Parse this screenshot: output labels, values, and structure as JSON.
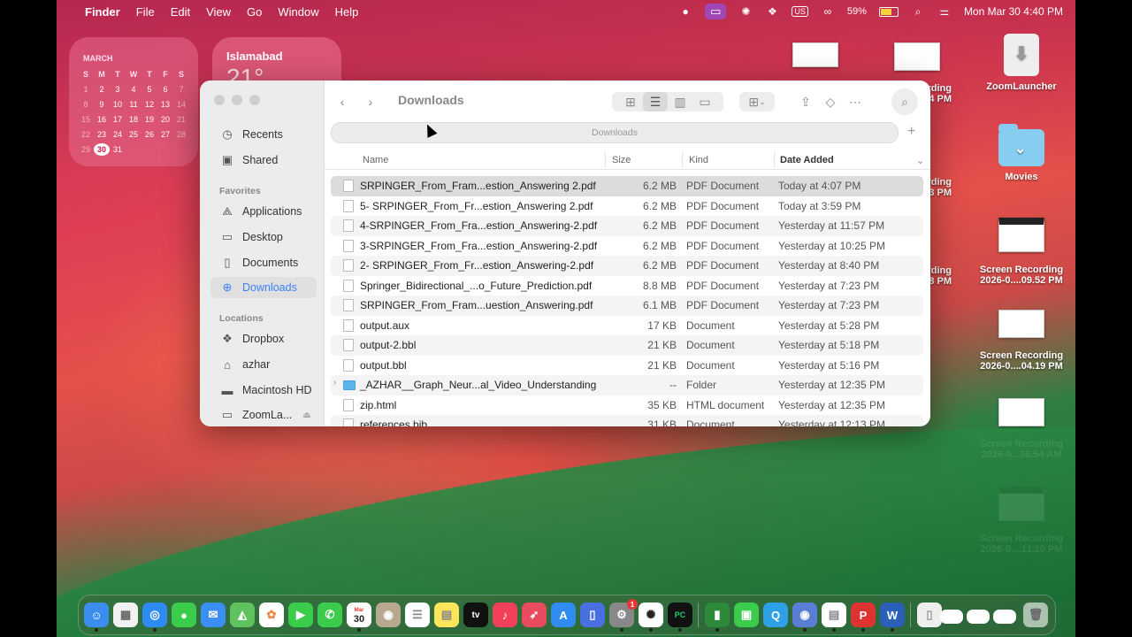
{
  "menubar": {
    "app_name": "Finder",
    "menus": [
      "File",
      "Edit",
      "View",
      "Go",
      "Window",
      "Help"
    ],
    "input_source": "US",
    "battery": "59%",
    "battery_level": 0.59,
    "datetime": "Mon Mar 30  4:40 PM"
  },
  "calendar_widget": {
    "month": "MARCH",
    "weekdays": [
      "S",
      "M",
      "T",
      "W",
      "T",
      "F",
      "S"
    ],
    "days": [
      "1",
      "2",
      "3",
      "4",
      "5",
      "6",
      "7",
      "8",
      "9",
      "10",
      "11",
      "12",
      "13",
      "14",
      "15",
      "16",
      "17",
      "18",
      "19",
      "20",
      "21",
      "22",
      "23",
      "24",
      "25",
      "26",
      "27",
      "28",
      "29",
      "30",
      "31"
    ],
    "today": "30"
  },
  "weather_widget": {
    "city": "Islamabad",
    "temp": "21°"
  },
  "desktop": {
    "items": [
      {
        "label": "ZoomLauncher"
      },
      {
        "label": "Movies"
      },
      {
        "label": "Screen Recording 2026-0....09.52 PM"
      },
      {
        "label": "Screen Recording 2026-0....04.19 PM"
      },
      {
        "label": "Screen Recording 2026-0...36.54 AM"
      },
      {
        "label": "Screen Recording 2026-0....11.10 PM"
      }
    ],
    "partial_labels": [
      "cording",
      "3.54 PM",
      "ecording",
      "4.33 PM",
      "cording",
      "3.48 PM"
    ]
  },
  "finder": {
    "title": "Downloads",
    "path_bar": "Downloads",
    "sidebar": {
      "top_items": [
        {
          "label": "Recents"
        },
        {
          "label": "Shared"
        }
      ],
      "favorites_header": "Favorites",
      "favorites": [
        {
          "label": "Applications"
        },
        {
          "label": "Desktop"
        },
        {
          "label": "Documents"
        },
        {
          "label": "Downloads"
        }
      ],
      "locations_header": "Locations",
      "locations": [
        {
          "label": "Dropbox"
        },
        {
          "label": "azhar"
        },
        {
          "label": "Macintosh HD"
        },
        {
          "label": "ZoomLa..."
        }
      ]
    },
    "columns": {
      "name": "Name",
      "size": "Size",
      "kind": "Kind",
      "date": "Date Added"
    },
    "files": [
      {
        "name": "SRPINGER_From_Fram...estion_Answering 2.pdf",
        "size": "6.2 MB",
        "kind": "PDF Document",
        "date": "Today at 4:07 PM"
      },
      {
        "name": "5- SRPINGER_From_Fr...estion_Answering 2.pdf",
        "size": "6.2 MB",
        "kind": "PDF Document",
        "date": "Today at 3:59 PM"
      },
      {
        "name": "4-SRPINGER_From_Fra...estion_Answering-2.pdf",
        "size": "6.2 MB",
        "kind": "PDF Document",
        "date": "Yesterday at 11:57 PM"
      },
      {
        "name": "3-SRPINGER_From_Fra...estion_Answering-2.pdf",
        "size": "6.2 MB",
        "kind": "PDF Document",
        "date": "Yesterday at 10:25 PM"
      },
      {
        "name": "2- SRPINGER_From_Fr...estion_Answering-2.pdf",
        "size": "6.2 MB",
        "kind": "PDF Document",
        "date": "Yesterday at 8:40 PM"
      },
      {
        "name": "Springer_Bidirectional_...o_Future_Prediction.pdf",
        "size": "8.8 MB",
        "kind": "PDF Document",
        "date": "Yesterday at 7:23 PM"
      },
      {
        "name": "SRPINGER_From_Fram...uestion_Answering.pdf",
        "size": "6.1 MB",
        "kind": "PDF Document",
        "date": "Yesterday at 7:23 PM"
      },
      {
        "name": "output.aux",
        "size": "17 KB",
        "kind": "Document",
        "date": "Yesterday at 5:28 PM"
      },
      {
        "name": "output-2.bbl",
        "size": "21 KB",
        "kind": "Document",
        "date": "Yesterday at 5:18 PM"
      },
      {
        "name": "output.bbl",
        "size": "21 KB",
        "kind": "Document",
        "date": "Yesterday at 5:16 PM"
      },
      {
        "name": "_AZHAR__Graph_Neur...al_Video_Understanding",
        "size": "--",
        "kind": "Folder",
        "date": "Yesterday at 12:35 PM"
      },
      {
        "name": "zip.html",
        "size": "35 KB",
        "kind": "HTML document",
        "date": "Yesterday at 12:35 PM"
      },
      {
        "name": "references.bib",
        "size": "31 KB",
        "kind": "Document",
        "date": "Yesterday at 12:13 PM"
      }
    ]
  },
  "dock": {
    "calendar_day": "30",
    "calendar_month": "Mar",
    "appletv_label": "tv",
    "badge_count": "1"
  },
  "colors": {
    "accent": "#3a82f7",
    "selected_row": "#dcdcdc",
    "folder_blue": "#5db3ee"
  }
}
